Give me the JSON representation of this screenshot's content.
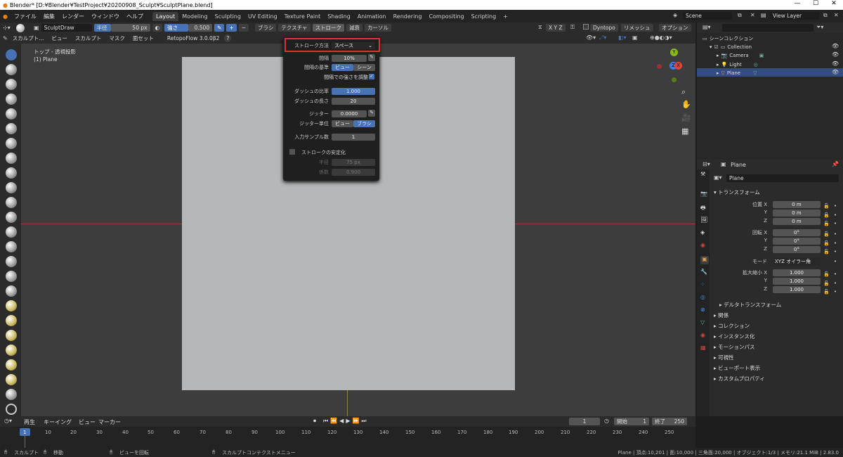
{
  "window": {
    "title": "Blender* [D:¥Blender¥TestProject¥20200908_Sculpt¥SculptPlane.blend]",
    "min": "—",
    "max": "☐",
    "close": "✕"
  },
  "menu": {
    "items": [
      "ファイル",
      "編集",
      "レンダー",
      "ウィンドウ",
      "ヘルプ"
    ],
    "workspaces": [
      "Layout",
      "Modeling",
      "Sculpting",
      "UV Editing",
      "Texture Paint",
      "Shading",
      "Animation",
      "Rendering",
      "Compositing",
      "Scripting"
    ],
    "add": "+",
    "scene": "Scene",
    "view_layer": "View Layer"
  },
  "header": {
    "brush_name": "SculptDraw",
    "radius_label": "半径",
    "radius_value": "50 px",
    "strength_label": "強さ",
    "strength_value": "0.500",
    "plus": "+",
    "minus": "−",
    "brush": "ブラシ",
    "texture": "テクスチャ",
    "stroke": "ストローク",
    "falloff": "減衰",
    "cursor": "カーソル",
    "xyz": "X Y Z",
    "dyntopo": "Dyntopo",
    "remesh": "リメッシュ",
    "options": "オプション"
  },
  "header2": {
    "mode": "スカルプト...",
    "view": "ビュー",
    "sculpt": "スカルプト",
    "mask": "マスク",
    "face_sets": "面セット",
    "addon": "RetopoFlow 3.0.0β2",
    "help": "?"
  },
  "viewport": {
    "view_name": "トップ - 透視投影",
    "object": "(1) Plane",
    "gizmo_y": "Y",
    "gizmo_z": "Z",
    "gizmo_x": "X"
  },
  "stroke_popup": {
    "method_label": "ストローク方法",
    "method_value": "スペース",
    "spacing_label": "間隔",
    "spacing_value": "10%",
    "spacing_base_label": "間隔の基準",
    "view": "ビュー",
    "scene": "シーン",
    "adjust_strength": "間隔での強さを調整",
    "dash_ratio_label": "ダッシュの比率",
    "dash_ratio_value": "1.000",
    "dash_length_label": "ダッシュの長さ",
    "dash_length_value": "20",
    "jitter_label": "ジッター",
    "jitter_value": "0.0000",
    "jitter_unit_label": "ジッター単位",
    "brush": "ブラシ",
    "input_samples_label": "入力サンプル数",
    "input_samples_value": "1",
    "stabilize": "ストロークの安定化",
    "radius_label": "半径",
    "radius_value": "75 px",
    "factor_label": "係数",
    "factor_value": "0.900"
  },
  "outliner": {
    "scene_collection": "シーンコレクション",
    "collection": "Collection",
    "camera": "Camera",
    "light": "Light",
    "plane": "Plane"
  },
  "properties": {
    "object_name": "Plane",
    "name_field": "Plane",
    "transform": "トランスフォーム",
    "location_label": "位置 X",
    "rotation_label": "回転 X",
    "scale_label": "拡大縮小 X",
    "y": "Y",
    "z": "Z",
    "loc_x": "0 m",
    "loc_y": "0 m",
    "loc_z": "0 m",
    "rot_x": "0°",
    "rot_y": "0°",
    "rot_z": "0°",
    "mode_label": "モード",
    "mode_value": "XYZ オイラー角",
    "scale_x": "1.000",
    "scale_y": "1.000",
    "scale_z": "1.000",
    "delta": "デルタトランスフォーム",
    "sections": [
      "関係",
      "コレクション",
      "インスタンス化",
      "モーションパス",
      "可視性",
      "ビューポート表示",
      "カスタムプロパティ"
    ]
  },
  "timeline": {
    "playback": "再生",
    "keying": "キーイング",
    "view": "ビュー",
    "marker": "マーカー",
    "current": "1",
    "start_label": "開始",
    "start": "1",
    "end_label": "終了",
    "end": "250",
    "ticks": [
      "1",
      "10",
      "20",
      "30",
      "40",
      "50",
      "60",
      "70",
      "80",
      "90",
      "100",
      "110",
      "120",
      "130",
      "140",
      "150",
      "160",
      "170",
      "180",
      "190",
      "200",
      "210",
      "220",
      "230",
      "240",
      "250"
    ]
  },
  "status": {
    "sculpt": "スカルプト",
    "move": "移動",
    "rotate_view": "ビューを回転",
    "context_menu": "スカルプトコンテクストメニュー",
    "stats": "Plane | 頂点:10,201 | 面:10,000 | 三角面:20,000 | オブジェクト:1/3 | メモリ:21.1 MiB | 2.83.0"
  },
  "colors": {
    "accent": "#4772b3",
    "highlight": "#e0312d",
    "plane": "#b5b7b8",
    "viewport": "#3d3d3d"
  }
}
